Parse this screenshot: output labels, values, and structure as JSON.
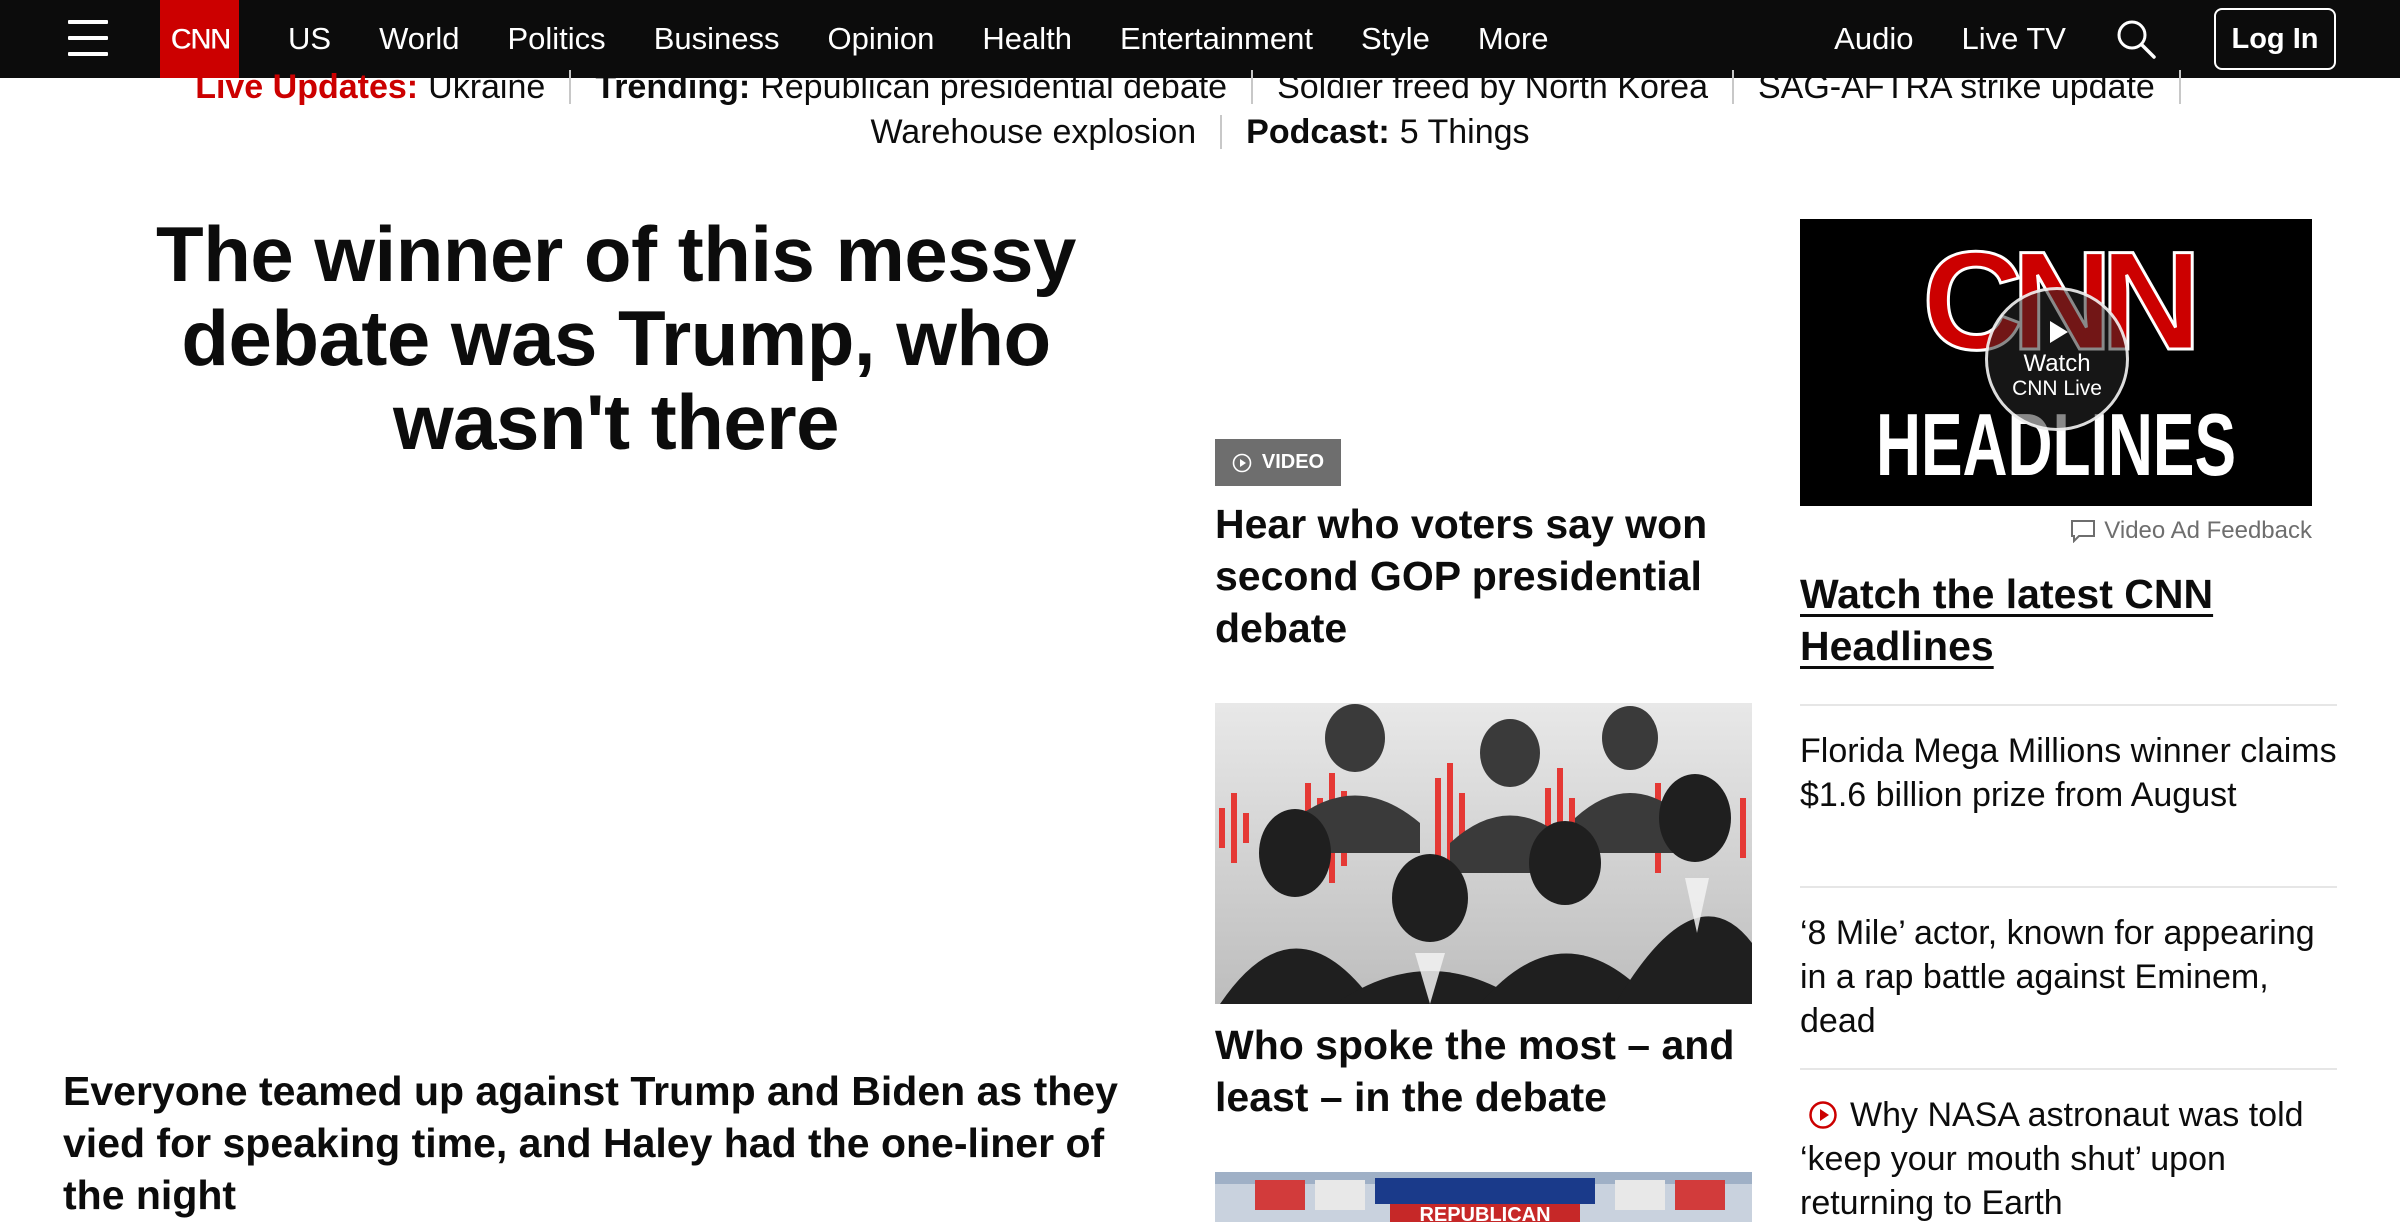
{
  "colors": {
    "brand_red": "#cc0000",
    "nav_bg": "#0c0c0c",
    "text": "#0c0c0c",
    "muted": "#6e6e6e",
    "divider": "#e6e6e6"
  },
  "header": {
    "logo_text": "CNN",
    "menu_icon": "hamburger-menu-icon",
    "nav_items": [
      "US",
      "World",
      "Politics",
      "Business",
      "Opinion",
      "Health",
      "Entertainment",
      "Style",
      "More"
    ],
    "audio_label": "Audio",
    "live_tv_label": "Live TV",
    "search_icon": "search-icon",
    "login_label": "Log In"
  },
  "trending": {
    "live_label": "Live Updates:",
    "live_topic": "Ukraine",
    "trending_label": "Trending:",
    "items": [
      "Republican presidential debate",
      "Soldier freed by North Korea",
      "SAG-AFTRA strike update",
      "Warehouse explosion"
    ],
    "podcast_label": "Podcast:",
    "podcast_name": "5 Things"
  },
  "lead": {
    "headline": "The winner of this messy debate was Trump, who wasn't there",
    "subheadline": "Everyone teamed up against Trump and Biden as they vied for speaking time, and Haley had the one-liner of the night"
  },
  "middle": {
    "video_badge": "VIDEO",
    "story1": "Hear who voters say won second GOP presidential debate",
    "story2": "Who spoke the most – and least – in the debate",
    "bottom_image_text": "REPUBLICAN"
  },
  "right": {
    "video_logo": "CNN",
    "video_title_graphic": "HEADLINES",
    "watch_label_1": "Watch",
    "watch_label_2": "CNN Live",
    "ad_feedback": "Video Ad Feedback",
    "watch_link": "Watch the latest CNN Headlines",
    "stories": [
      "Florida Mega Millions winner claims $1.6 billion prize from August",
      "‘8 Mile’ actor, known for appearing in a rap battle against Eminem, dead",
      "Why NASA astronaut was told ‘keep your mouth shut’ upon returning to Earth"
    ]
  }
}
